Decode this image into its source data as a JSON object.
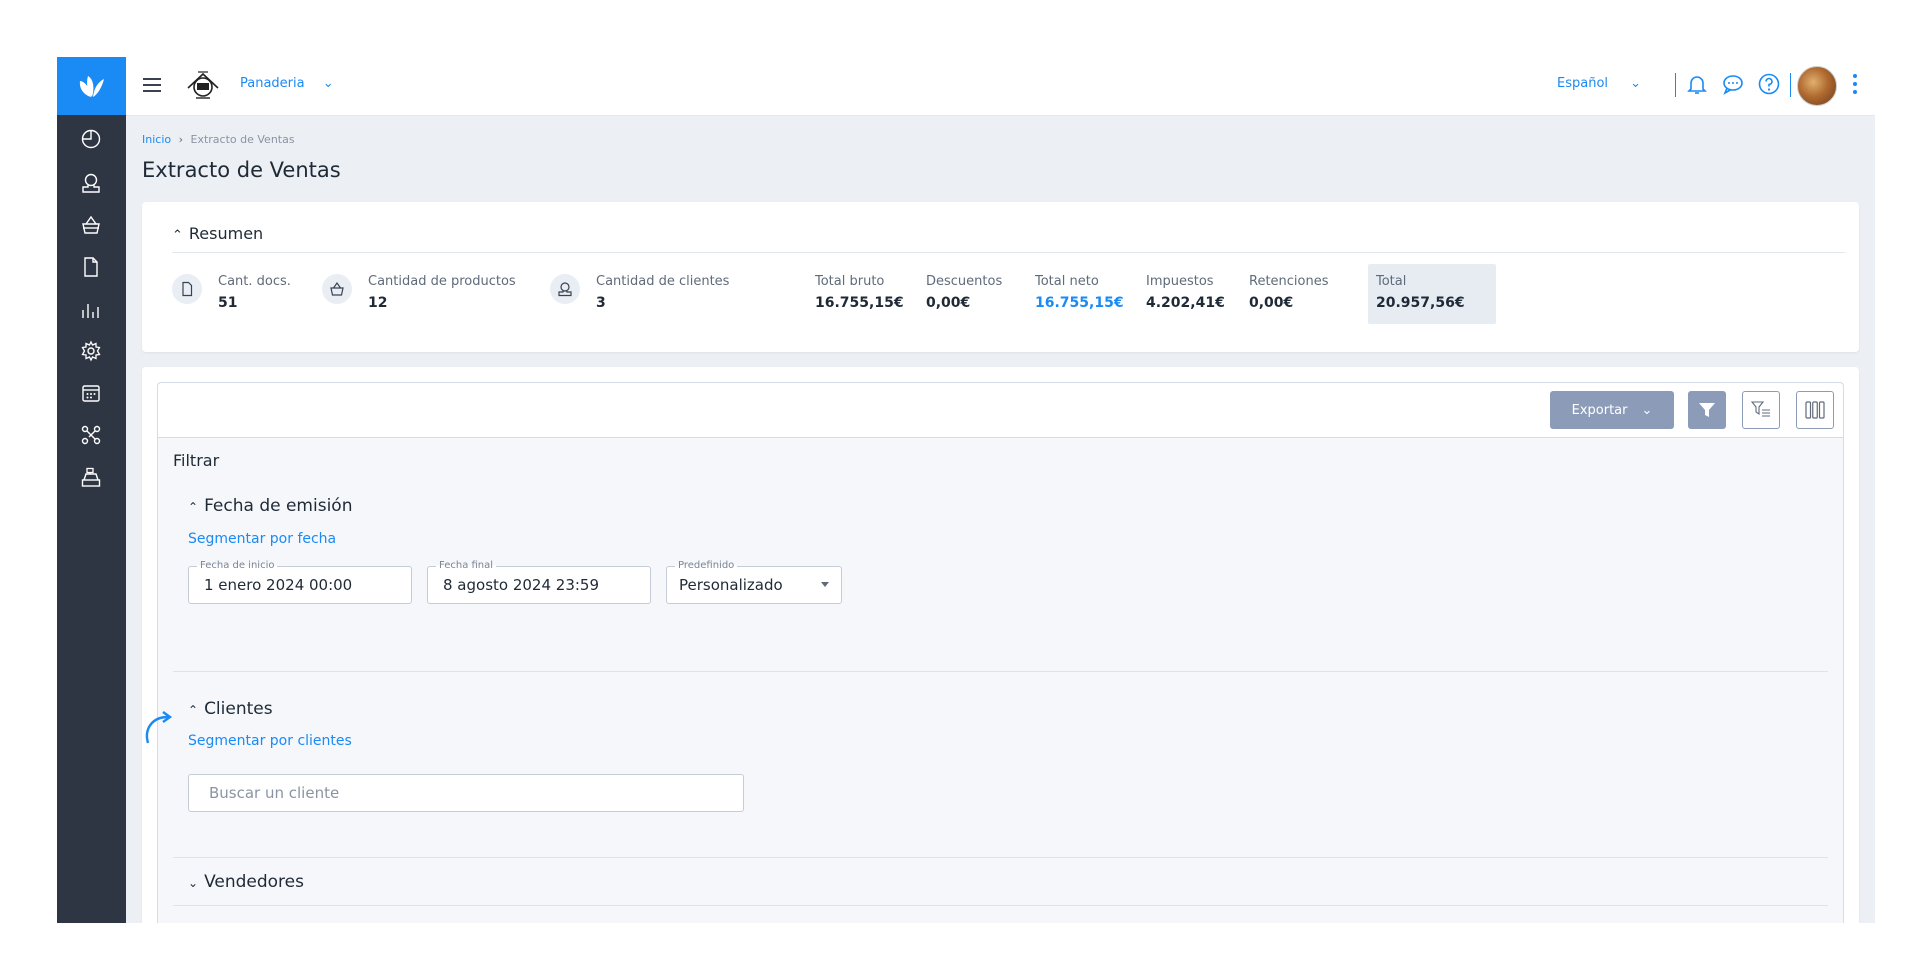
{
  "header": {
    "company": "Panaderia",
    "language": "Español"
  },
  "breadcrumb": {
    "home": "Inicio",
    "separator": "›",
    "current": "Extracto de Ventas"
  },
  "page_title": "Extracto de Ventas",
  "summary": {
    "title": "Resumen",
    "stats": {
      "docs": {
        "label": "Cant. docs.",
        "value": "51"
      },
      "products": {
        "label": "Cantidad de productos",
        "value": "12"
      },
      "clients": {
        "label": "Cantidad de clientes",
        "value": "3"
      },
      "gross": {
        "label": "Total bruto",
        "value": "16.755,15€"
      },
      "discounts": {
        "label": "Descuentos",
        "value": "0,00€"
      },
      "net": {
        "label": "Total neto",
        "value": "16.755,15€"
      },
      "taxes": {
        "label": "Impuestos",
        "value": "4.202,41€"
      },
      "withholdings": {
        "label": "Retenciones",
        "value": "0,00€"
      },
      "total": {
        "label": "Total",
        "value": "20.957,56€"
      }
    }
  },
  "toolbar": {
    "export_label": "Exportar"
  },
  "filters": {
    "title": "Filtrar",
    "date_section": {
      "title": "Fecha de emisión",
      "segment_link": "Segmentar por fecha",
      "start": {
        "label": "Fecha de inicio",
        "value": "1 enero 2024 00:00"
      },
      "end": {
        "label": "Fecha final",
        "value": "8 agosto 2024 23:59"
      },
      "preset": {
        "label": "Predefinido",
        "value": "Personalizado"
      }
    },
    "clients_section": {
      "title": "Clientes",
      "segment_link": "Segmentar por clientes",
      "search_placeholder": "Buscar un cliente"
    },
    "sellers_section": {
      "title": "Vendedores"
    }
  },
  "colors": {
    "accent": "#1a8af5",
    "sidebar": "#2f3643",
    "button": "#8c9cb8"
  }
}
